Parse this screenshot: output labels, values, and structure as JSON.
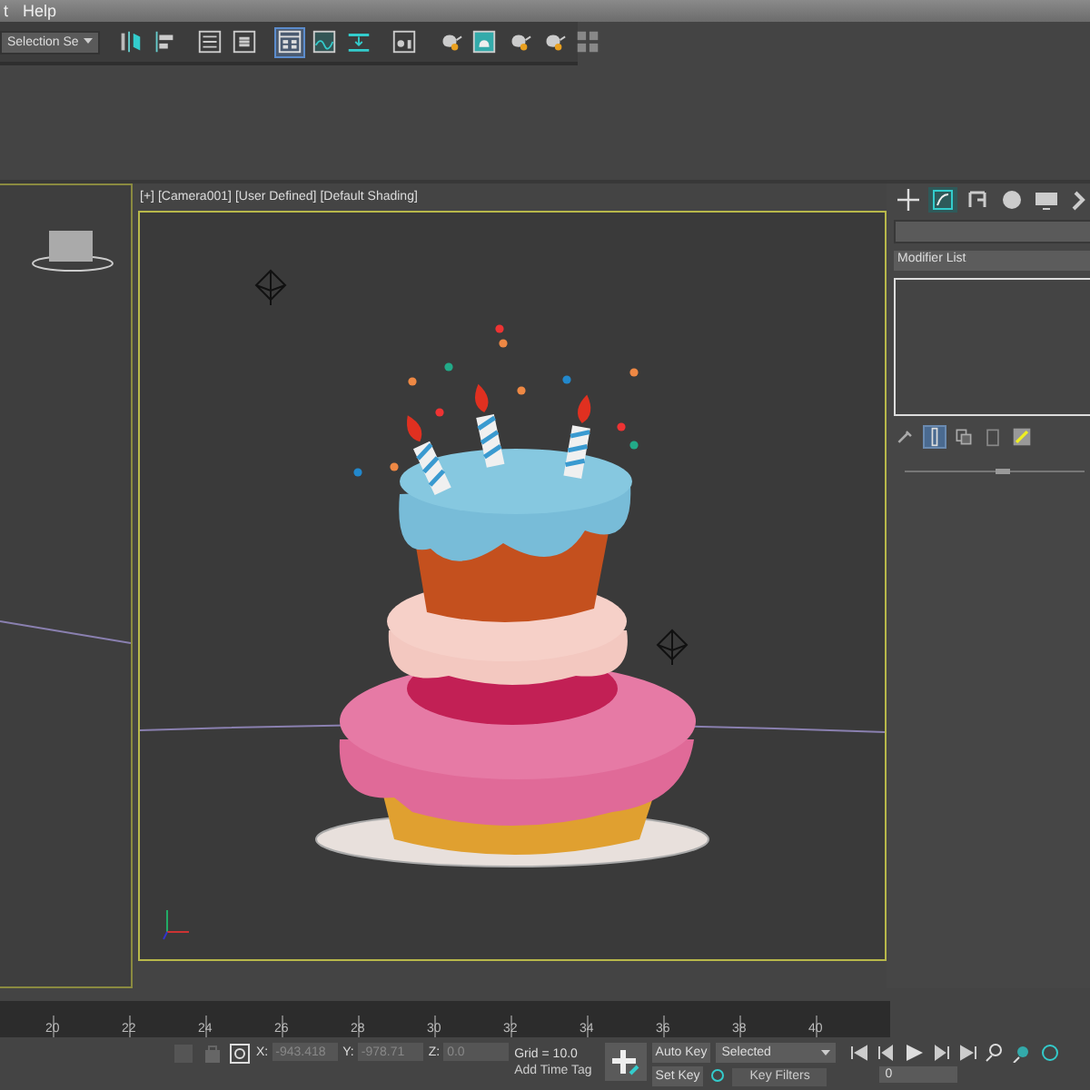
{
  "menu": [
    {
      "label": "t"
    },
    {
      "label": "Help"
    }
  ],
  "toolbar": {
    "selection_set": "Selection Se",
    "tools": [
      {
        "kind": "mirror",
        "selected": false
      },
      {
        "kind": "align",
        "selected": false
      },
      {
        "kind": "list",
        "selected": false
      },
      {
        "kind": "layers",
        "selected": false
      },
      {
        "kind": "grid-window",
        "selected": true
      },
      {
        "kind": "curve-window",
        "selected": false
      },
      {
        "kind": "dope-sheet",
        "selected": false
      },
      {
        "kind": "material",
        "selected": false
      },
      {
        "kind": "teapot",
        "selected": false
      },
      {
        "kind": "render-window",
        "selected": false
      },
      {
        "kind": "teapot",
        "selected": false
      },
      {
        "kind": "teapot",
        "selected": false
      },
      {
        "kind": "quad",
        "selected": false
      }
    ]
  },
  "viewport": {
    "labels": [
      "[+]",
      "[Camera001]",
      "[User Defined]",
      "[Default Shading]"
    ]
  },
  "command_panel": {
    "tabs": [
      {
        "kind": "create",
        "selected": false
      },
      {
        "kind": "modify",
        "selected": true
      },
      {
        "kind": "hierarchy",
        "selected": false
      },
      {
        "kind": "motion",
        "selected": false
      },
      {
        "kind": "display",
        "selected": false
      },
      {
        "kind": "utilities",
        "selected": false
      }
    ],
    "modifier_list": "Modifier List",
    "stack_tools": [
      {
        "kind": "pin",
        "selected": false
      },
      {
        "kind": "show-end",
        "selected": true
      },
      {
        "kind": "unique",
        "selected": false
      },
      {
        "kind": "remove",
        "selected": false
      },
      {
        "kind": "configure",
        "selected": false
      }
    ]
  },
  "timeline": {
    "ticks": [
      "20",
      "22",
      "24",
      "26",
      "28",
      "30",
      "32",
      "34",
      "36",
      "38",
      "40"
    ]
  },
  "status_bar": {
    "coordinates": [
      {
        "label": "X:",
        "value": "-943.418"
      },
      {
        "label": "Y:",
        "value": "-978.71"
      },
      {
        "label": "Z:",
        "value": "0.0"
      }
    ],
    "grid": "Grid = 10.0",
    "add_time_tag": "Add Time Tag"
  },
  "animation": {
    "auto_key": "Auto Key",
    "key_mode": "Selected",
    "set_key": "Set Key",
    "key_filters": "Key Filters",
    "frame": "0"
  }
}
